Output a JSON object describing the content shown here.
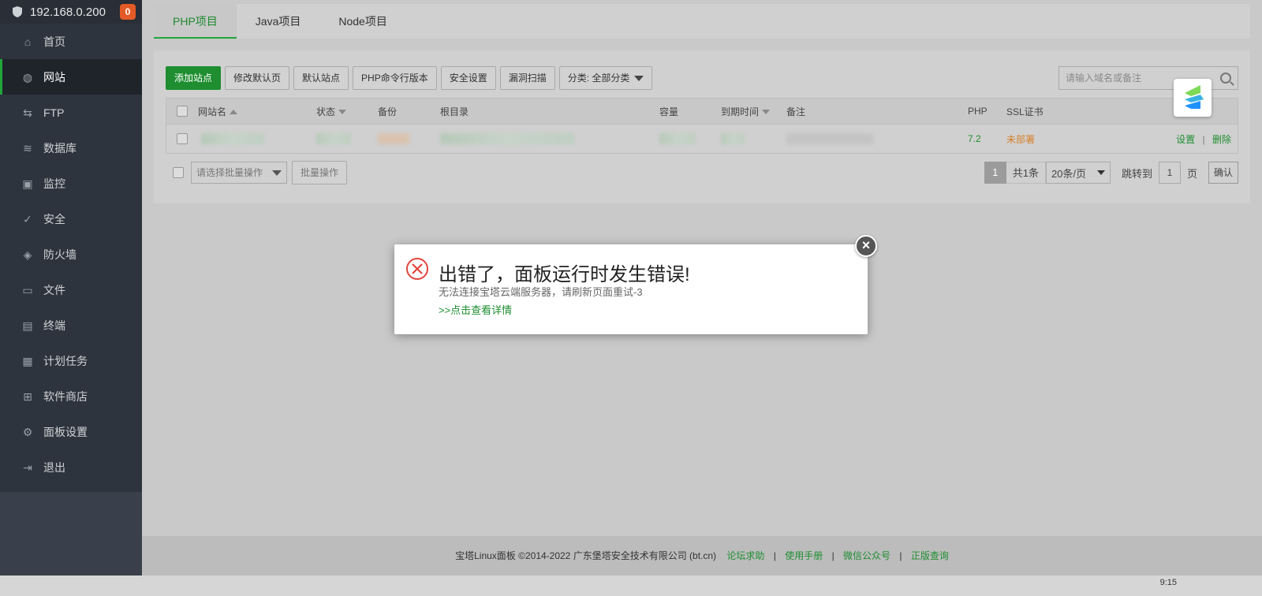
{
  "sidebar": {
    "ip": "192.168.0.200",
    "badge": "0",
    "items": [
      {
        "label": "首页",
        "icon": "home-icon"
      },
      {
        "label": "网站",
        "icon": "globe-icon",
        "active": true
      },
      {
        "label": "FTP",
        "icon": "ftp-icon"
      },
      {
        "label": "数据库",
        "icon": "database-icon"
      },
      {
        "label": "监控",
        "icon": "monitor-icon"
      },
      {
        "label": "安全",
        "icon": "shield-check-icon"
      },
      {
        "label": "防火墙",
        "icon": "firewall-icon"
      },
      {
        "label": "文件",
        "icon": "folder-icon"
      },
      {
        "label": "终端",
        "icon": "terminal-icon"
      },
      {
        "label": "计划任务",
        "icon": "calendar-icon"
      },
      {
        "label": "软件商店",
        "icon": "grid-icon"
      },
      {
        "label": "面板设置",
        "icon": "gear-icon"
      },
      {
        "label": "退出",
        "icon": "logout-icon"
      }
    ]
  },
  "tabs": [
    "PHP项目",
    "Java项目",
    "Node项目"
  ],
  "toolbar": {
    "add_site": "添加站点",
    "edit_default": "修改默认页",
    "default_site": "默认站点",
    "php_cli": "PHP命令行版本",
    "security": "安全设置",
    "vuln_scan": "漏洞扫描",
    "category": "分类: 全部分类"
  },
  "search": {
    "placeholder": "请输入域名或备注"
  },
  "table": {
    "headers": {
      "name": "网站名",
      "status": "状态",
      "backup": "备份",
      "root": "根目录",
      "capacity": "容量",
      "expire": "到期时间",
      "note": "备注",
      "php": "PHP",
      "ssl": "SSL证书"
    },
    "row": {
      "php": "7.2",
      "ssl": "未部署",
      "settings": "设置",
      "divider": "|",
      "delete": "删除"
    }
  },
  "batch": {
    "select_placeholder": "请选择批量操作",
    "button": "批量操作"
  },
  "pager": {
    "current": "1",
    "total": "共1条",
    "per_page": "20条/页",
    "goto": "跳转到",
    "goto_value": "1",
    "page_unit": "页",
    "confirm": "确认"
  },
  "modal": {
    "title": "出错了，面板运行时发生错误!",
    "message": "无法连接宝塔云端服务器，请刷新页面重试-3",
    "details": ">>点击查看详情",
    "close": "×"
  },
  "footer": {
    "copyright": "宝塔Linux面板 ©2014-2022 广东堡塔安全技术有限公司 (bt.cn)",
    "links": [
      "论坛求助",
      "使用手册",
      "微信公众号",
      "正版查询"
    ],
    "sep": "|"
  },
  "taskbar": {
    "time": "9:15"
  },
  "colors": {
    "accent": "#20a53a",
    "error": "#e0463c",
    "warning": "#d7802a"
  }
}
